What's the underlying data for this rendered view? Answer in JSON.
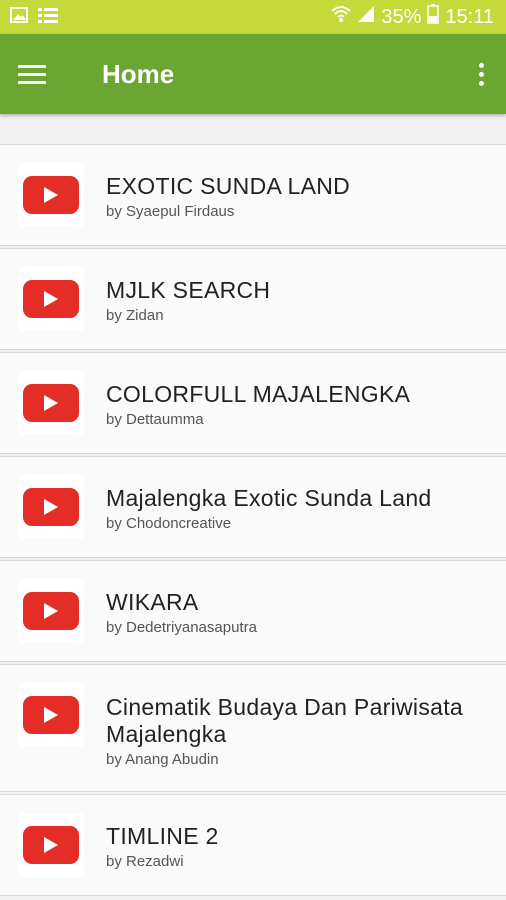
{
  "status_bar": {
    "battery_percent": "35%",
    "time": "15:11",
    "icons": [
      "image-icon",
      "checklist-icon",
      "wifi-icon",
      "signal-icon",
      "battery-icon"
    ]
  },
  "app_bar": {
    "title": "Home",
    "icons": [
      "menu-icon",
      "more-vert-icon"
    ]
  },
  "colors": {
    "status_bar": "#c6d93a",
    "app_bar": "#6aa632",
    "youtube_red": "#e52d27"
  },
  "videos": [
    {
      "title": "EXOTIC SUNDA LAND",
      "author": "by Syaepul Firdaus"
    },
    {
      "title": "MJLK SEARCH",
      "author": "by Zidan"
    },
    {
      "title": "COLORFULL MAJALENGKA",
      "author": "by Dettaumma"
    },
    {
      "title": "Majalengka Exotic Sunda Land",
      "author": "by Chodoncreative"
    },
    {
      "title": "WIKARA",
      "author": "by Dedetriyanasaputra"
    },
    {
      "title": "Cinematik Budaya Dan Pariwisata Majalengka",
      "author": "by Anang Abudin"
    },
    {
      "title": "TIMLINE 2",
      "author": "by Rezadwi"
    }
  ]
}
